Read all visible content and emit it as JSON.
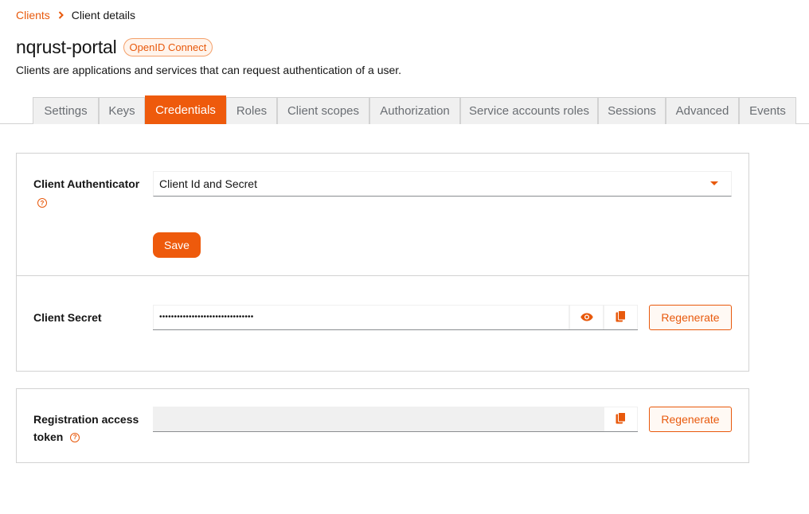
{
  "breadcrumb": {
    "parent": "Clients",
    "current": "Client details"
  },
  "header": {
    "title": "nqrust-portal",
    "badge": "OpenID Connect",
    "subtitle": "Clients are applications and services that can request authentication of a user."
  },
  "tabs": [
    {
      "label": "Settings",
      "active": false
    },
    {
      "label": "Keys",
      "active": false
    },
    {
      "label": "Credentials",
      "active": true
    },
    {
      "label": "Roles",
      "active": false
    },
    {
      "label": "Client scopes",
      "active": false
    },
    {
      "label": "Authorization",
      "active": false
    },
    {
      "label": "Service accounts roles",
      "active": false
    },
    {
      "label": "Sessions",
      "active": false
    },
    {
      "label": "Advanced",
      "active": false
    },
    {
      "label": "Events",
      "active": false
    }
  ],
  "credentials": {
    "authenticator_label": "Client Authenticator",
    "authenticator_value": "Client Id and Secret",
    "save_label": "Save",
    "secret_label": "Client Secret",
    "secret_masked": "••••••••••••••••••••••••••••••••",
    "regenerate_label": "Regenerate"
  },
  "registration": {
    "label_line1": "Registration access",
    "label_line2": "token",
    "regenerate_label": "Regenerate"
  },
  "colors": {
    "accent": "#ee5a0c",
    "border": "#d2d2d2"
  }
}
